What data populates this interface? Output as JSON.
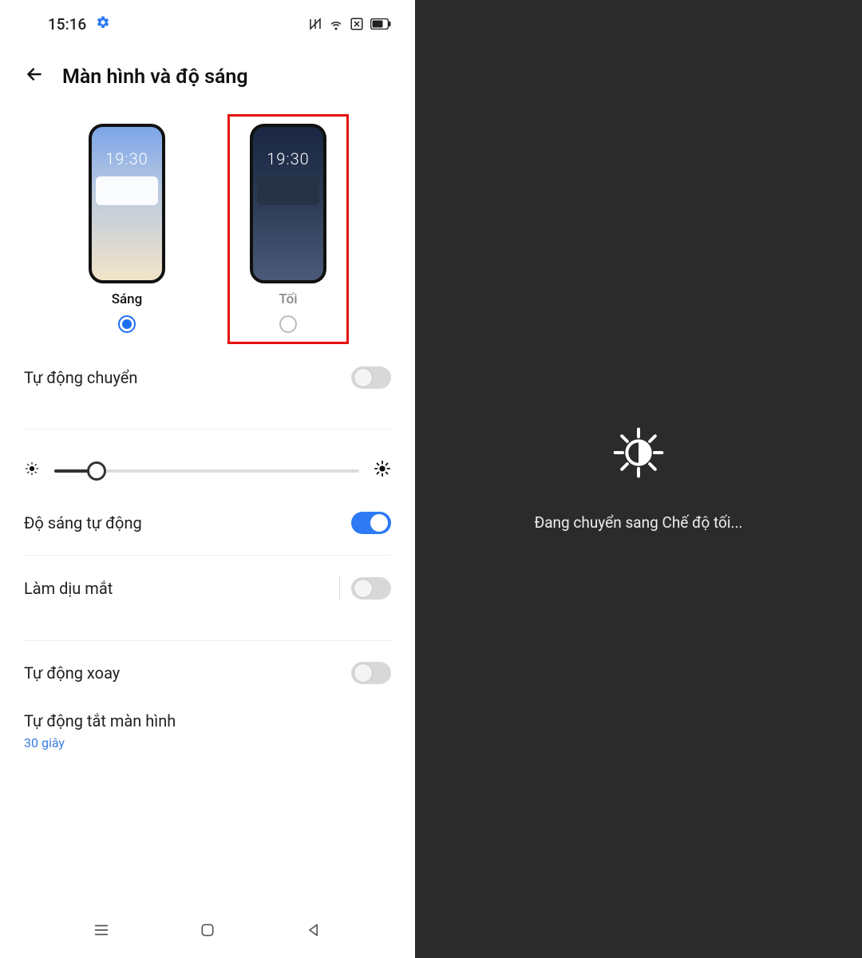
{
  "status": {
    "time": "15:16"
  },
  "header": {
    "title": "Màn hình và độ sáng"
  },
  "themes": {
    "light": {
      "label": "Sáng",
      "preview_time": "19:30",
      "selected": true
    },
    "dark": {
      "label": "Tối",
      "preview_time": "19:30",
      "selected": false,
      "highlighted": true
    }
  },
  "settings": {
    "auto_switch": {
      "label": "Tự động chuyển",
      "enabled": false
    },
    "brightness_percent": 14,
    "auto_brightness": {
      "label": "Độ sáng tự động",
      "enabled": true
    },
    "eye_comfort": {
      "label": "Làm dịu mắt",
      "enabled": false
    },
    "auto_rotate": {
      "label": "Tự động xoay",
      "enabled": false
    },
    "screen_off": {
      "label": "Tự động tắt màn hình",
      "value": "30 giây"
    }
  },
  "right_panel": {
    "message": "Đang chuyển sang Chế độ tối..."
  }
}
